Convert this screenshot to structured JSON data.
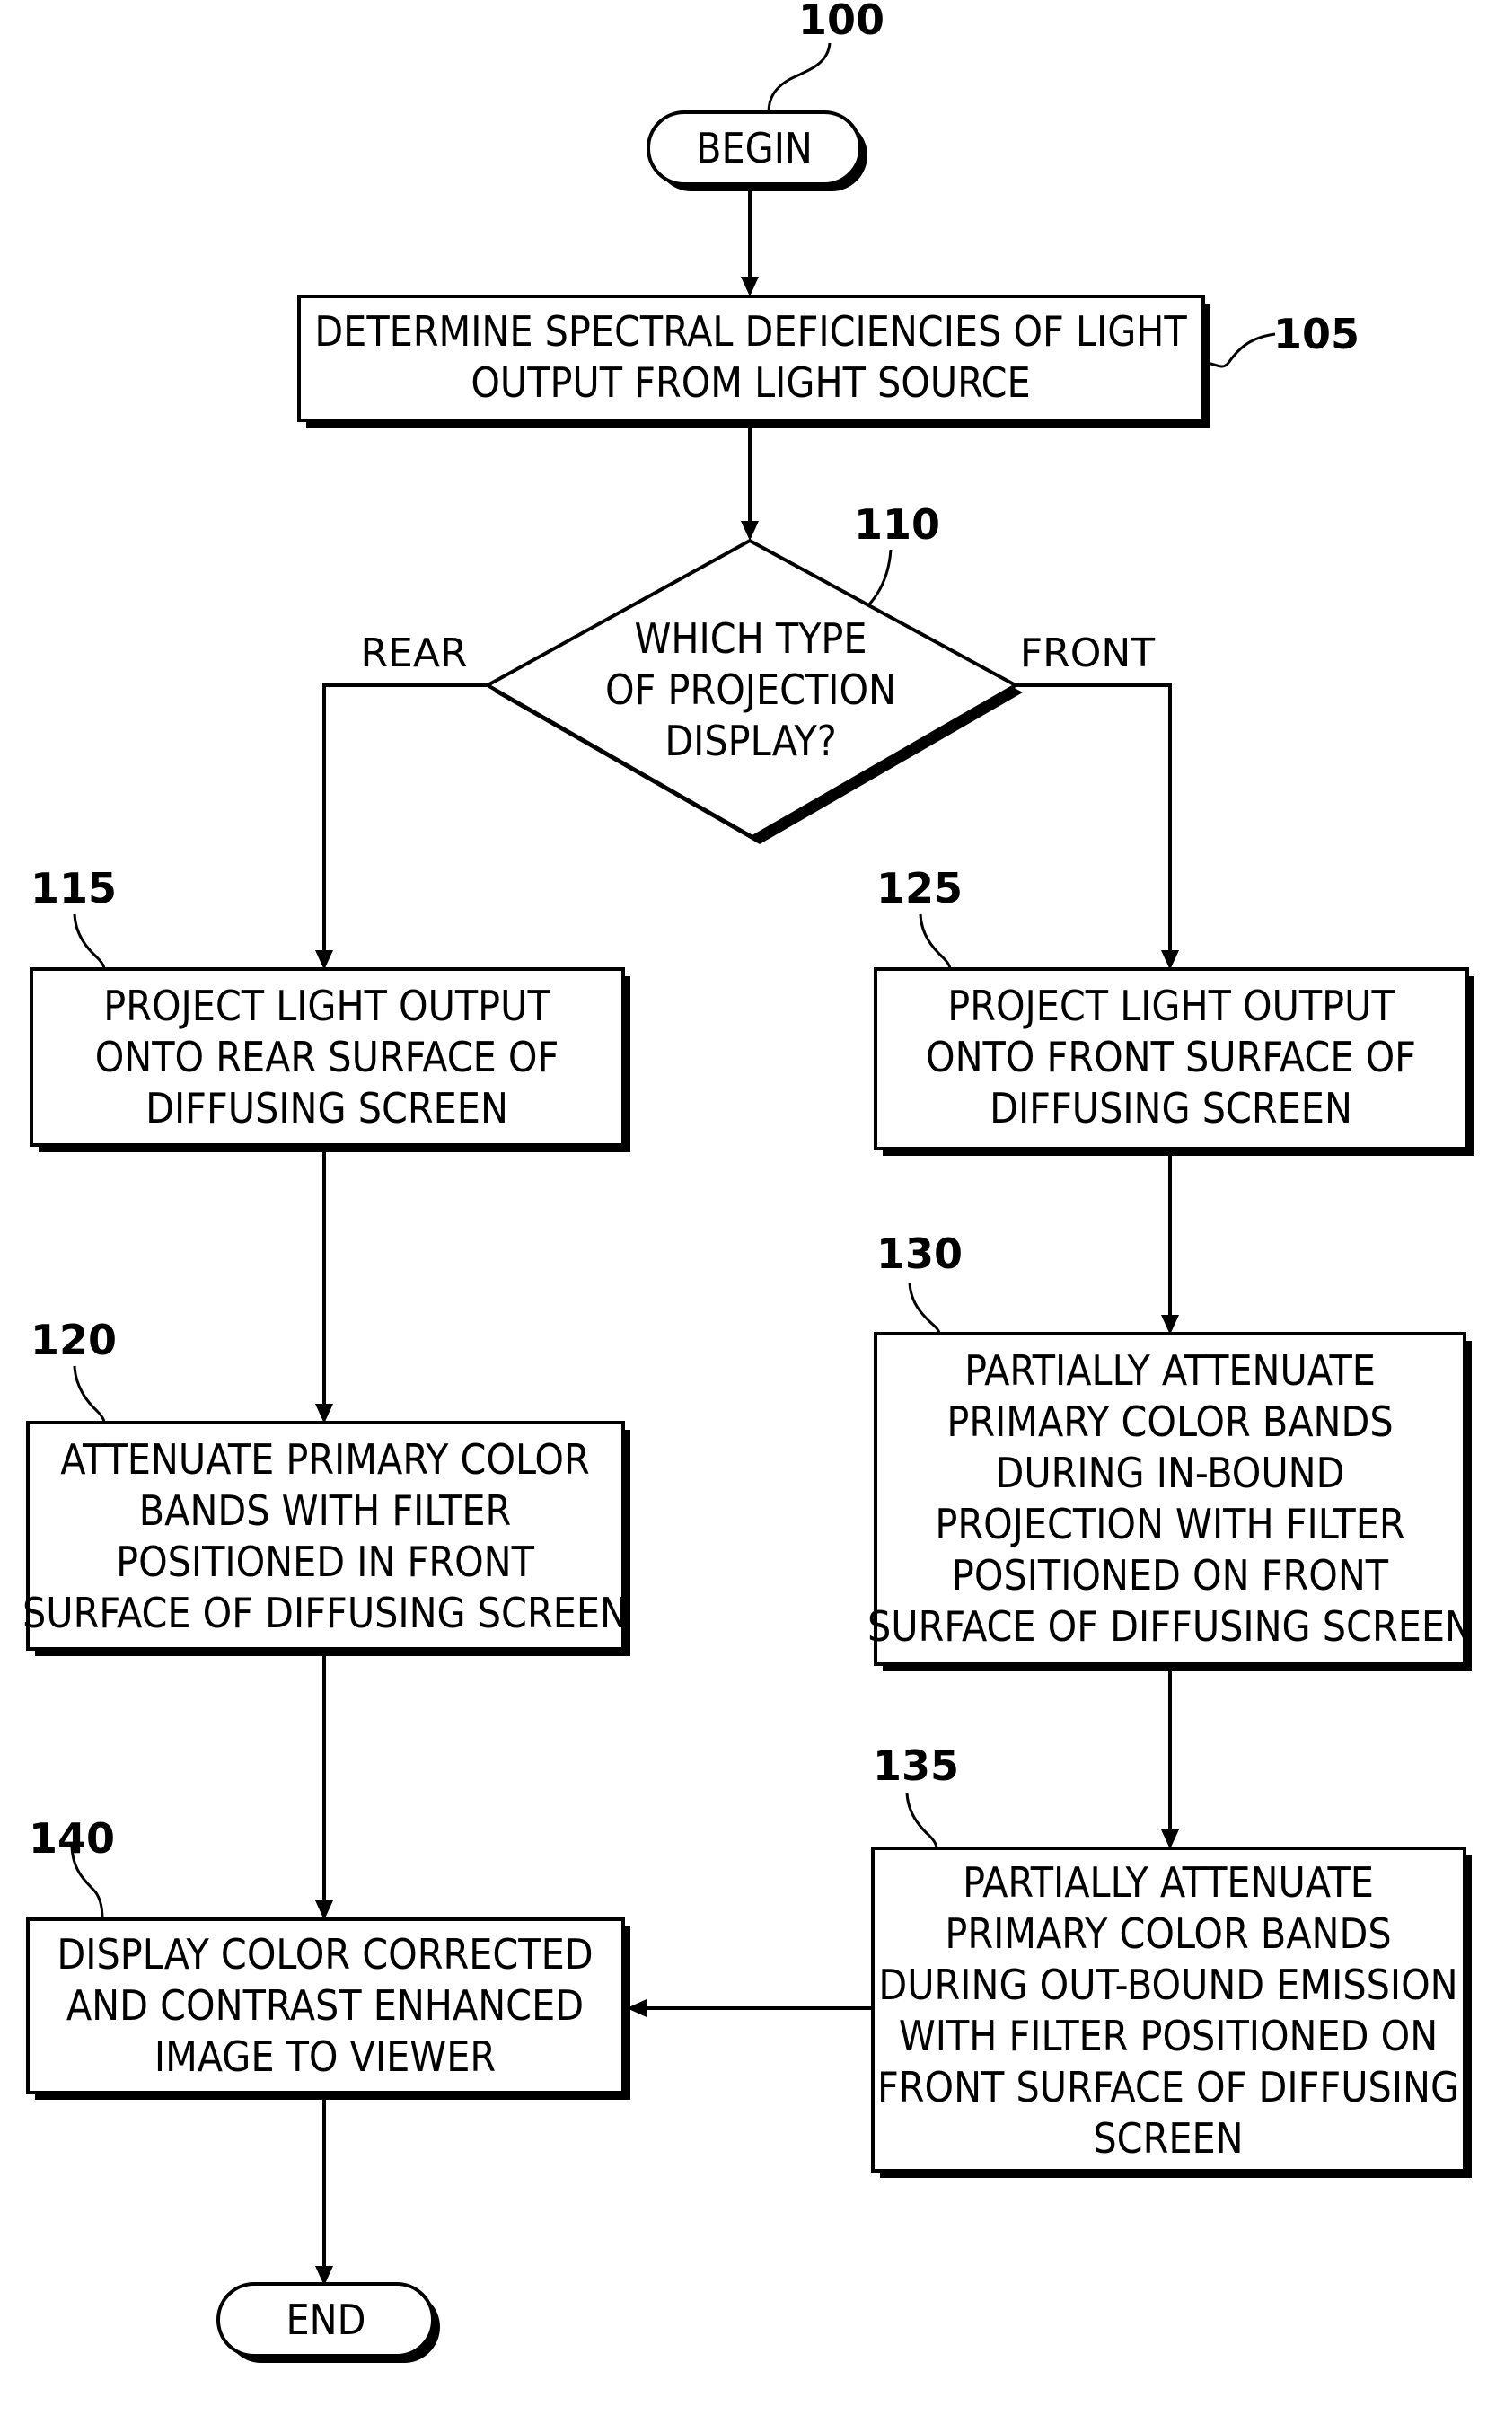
{
  "figure": {
    "type": "flowchart",
    "reference": "100"
  },
  "nodes": {
    "begin": {
      "ref": "100",
      "shape": "terminal",
      "lines": [
        "BEGIN"
      ]
    },
    "step105": {
      "ref": "105",
      "shape": "process",
      "lines": [
        "DETERMINE SPECTRAL DEFICIENCIES OF LIGHT",
        "OUTPUT FROM LIGHT SOURCE"
      ]
    },
    "decision110": {
      "ref": "110",
      "shape": "decision",
      "lines": [
        "WHICH TYPE",
        "OF PROJECTION",
        "DISPLAY?"
      ]
    },
    "step115": {
      "ref": "115",
      "shape": "process",
      "lines": [
        "PROJECT LIGHT OUTPUT",
        "ONTO REAR SURFACE OF",
        "DIFFUSING SCREEN"
      ]
    },
    "step120": {
      "ref": "120",
      "shape": "process",
      "lines": [
        "ATTENUATE PRIMARY COLOR",
        "BANDS WITH FILTER",
        "POSITIONED IN FRONT",
        "SURFACE OF DIFFUSING SCREEN"
      ]
    },
    "step125": {
      "ref": "125",
      "shape": "process",
      "lines": [
        "PROJECT LIGHT OUTPUT",
        "ONTO FRONT SURFACE OF",
        "DIFFUSING SCREEN"
      ]
    },
    "step130": {
      "ref": "130",
      "shape": "process",
      "lines": [
        "PARTIALLY ATTENUATE",
        "PRIMARY COLOR BANDS",
        "DURING IN-BOUND",
        "PROJECTION WITH FILTER",
        "POSITIONED ON FRONT",
        "SURFACE OF DIFFUSING SCREEN"
      ]
    },
    "step135": {
      "ref": "135",
      "shape": "process",
      "lines": [
        "PARTIALLY ATTENUATE",
        "PRIMARY COLOR BANDS",
        "DURING OUT-BOUND EMISSION",
        "WITH FILTER POSITIONED ON",
        "FRONT SURFACE OF DIFFUSING",
        "SCREEN"
      ]
    },
    "step140": {
      "ref": "140",
      "shape": "process",
      "lines": [
        "DISPLAY COLOR CORRECTED",
        "AND CONTRAST ENHANCED",
        "IMAGE TO VIEWER"
      ]
    },
    "end": {
      "shape": "terminal",
      "lines": [
        "END"
      ]
    }
  },
  "branches": {
    "rear": "REAR",
    "front": "FRONT"
  },
  "edges": [
    {
      "from": "begin",
      "to": "step105"
    },
    {
      "from": "step105",
      "to": "decision110"
    },
    {
      "from": "decision110",
      "to": "step115",
      "label": "REAR"
    },
    {
      "from": "decision110",
      "to": "step125",
      "label": "FRONT"
    },
    {
      "from": "step115",
      "to": "step120"
    },
    {
      "from": "step120",
      "to": "step140"
    },
    {
      "from": "step125",
      "to": "step130"
    },
    {
      "from": "step130",
      "to": "step135"
    },
    {
      "from": "step135",
      "to": "step140"
    },
    {
      "from": "step140",
      "to": "end"
    }
  ]
}
